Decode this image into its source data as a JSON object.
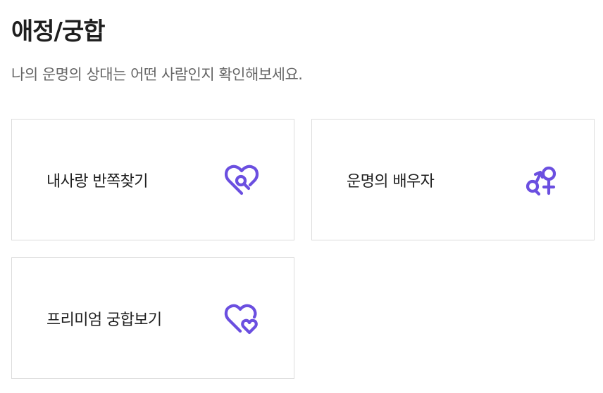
{
  "page": {
    "title": "애정/궁합",
    "subtitle": "나의 운명의 상대는 어떤 사람인지 확인해보세요."
  },
  "cards": [
    {
      "label": "내사랑 반쪽찾기",
      "icon": "heart-search-icon"
    },
    {
      "label": "운명의 배우자",
      "icon": "gender-symbols-icon"
    },
    {
      "label": "프리미엄 궁합보기",
      "icon": "double-heart-icon"
    }
  ],
  "colors": {
    "accent": "#6b4fe0",
    "title": "#1e1e1e",
    "subtitle": "#666666",
    "card_border": "#dcdcdc"
  }
}
